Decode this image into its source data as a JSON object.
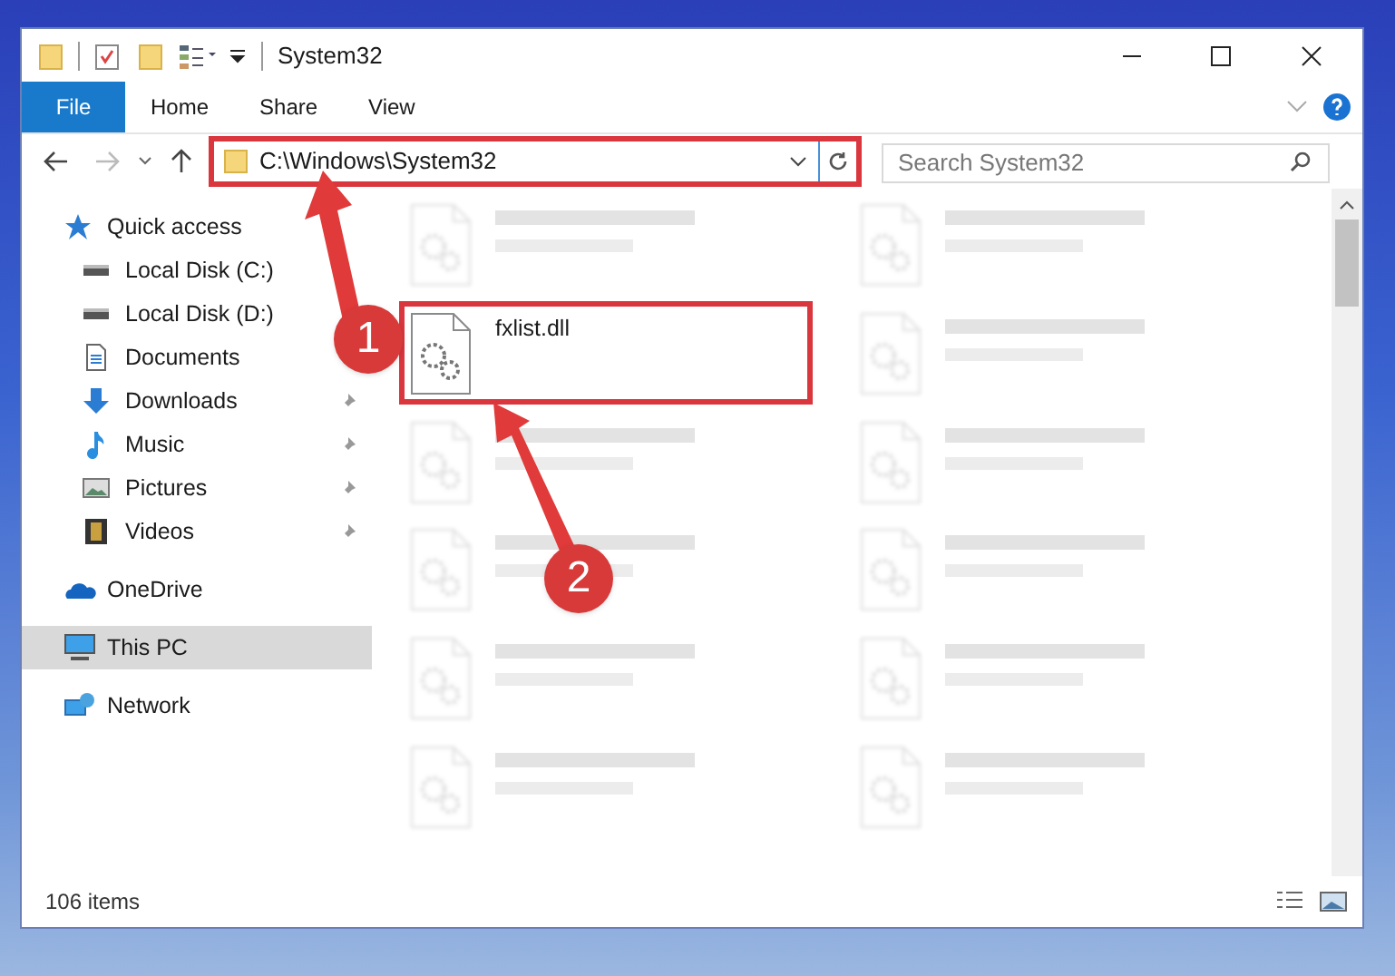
{
  "window": {
    "title": "System32"
  },
  "ribbon_tabs": [
    {
      "label": "File",
      "kind": "file"
    },
    {
      "label": "Home",
      "kind": "tab"
    },
    {
      "label": "Share",
      "kind": "tab"
    },
    {
      "label": "View",
      "kind": "tab"
    }
  ],
  "address_bar": {
    "path": "C:\\Windows\\System32",
    "highlighted": true
  },
  "search": {
    "placeholder": "Search System32"
  },
  "sidebar": {
    "items": [
      {
        "label": "Quick access",
        "kind": "star",
        "selected": false,
        "children": [
          {
            "label": "Local Disk (C:)",
            "kind": "disk",
            "pinned": false,
            "selected": false
          },
          {
            "label": "Local Disk (D:)",
            "kind": "disk",
            "pinned": false,
            "selected": false
          },
          {
            "label": "Documents",
            "kind": "documents",
            "pinned": false,
            "selected": false
          },
          {
            "label": "Downloads",
            "kind": "downloads",
            "pinned": true,
            "selected": false
          },
          {
            "label": "Music",
            "kind": "music",
            "pinned": true,
            "selected": false
          },
          {
            "label": "Pictures",
            "kind": "pictures",
            "pinned": true,
            "selected": false
          },
          {
            "label": "Videos",
            "kind": "videos",
            "pinned": true,
            "selected": false
          }
        ]
      },
      {
        "label": "OneDrive",
        "kind": "cloud",
        "selected": false
      },
      {
        "label": "This PC",
        "kind": "pc",
        "selected": true
      },
      {
        "label": "Network",
        "kind": "network",
        "selected": false
      }
    ]
  },
  "files": [
    {
      "kind": "blurred",
      "highlighted": false
    },
    {
      "kind": "blurred",
      "highlighted": false
    },
    {
      "kind": "file",
      "name": "fxlist.dll",
      "highlighted": true
    },
    {
      "kind": "blurred",
      "highlighted": false
    },
    {
      "kind": "blurred",
      "highlighted": false
    },
    {
      "kind": "blurred",
      "highlighted": false
    },
    {
      "kind": "blurred",
      "highlighted": false
    },
    {
      "kind": "blurred",
      "highlighted": false
    },
    {
      "kind": "blurred",
      "highlighted": false
    },
    {
      "kind": "blurred",
      "highlighted": false
    },
    {
      "kind": "blurred",
      "highlighted": false
    },
    {
      "kind": "blurred",
      "highlighted": false
    }
  ],
  "status_bar": {
    "count": "106 items"
  },
  "annotations": [
    {
      "number": "1"
    },
    {
      "number": "2"
    }
  ]
}
